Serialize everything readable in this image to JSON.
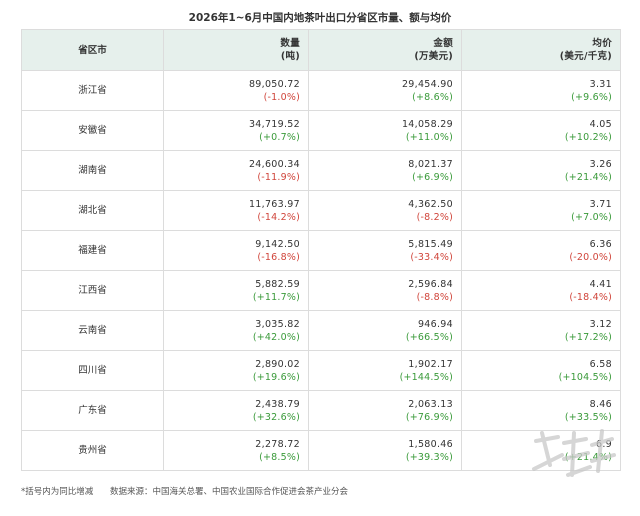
{
  "title": "2026年1~6月中国内地茶叶出口分省区市量、额与均价",
  "headers": {
    "province": "省区市",
    "qty_line1": "数量",
    "qty_line2": "(吨)",
    "amt_line1": "金额",
    "amt_line2": "(万美元)",
    "price_line1": "均价",
    "price_line2": "(美元/千克)"
  },
  "rows": [
    {
      "province": "浙江省",
      "qty": "89,050.72",
      "qty_chg": "(-1.0%)",
      "amt": "29,454.90",
      "amt_chg": "(+8.6%)",
      "price": "3.31",
      "price_chg": "(+9.6%)"
    },
    {
      "province": "安徽省",
      "qty": "34,719.52",
      "qty_chg": "(+0.7%)",
      "amt": "14,058.29",
      "amt_chg": "(+11.0%)",
      "price": "4.05",
      "price_chg": "(+10.2%)"
    },
    {
      "province": "湖南省",
      "qty": "24,600.34",
      "qty_chg": "(-11.9%)",
      "amt": "8,021.37",
      "amt_chg": "(+6.9%)",
      "price": "3.26",
      "price_chg": "(+21.4%)"
    },
    {
      "province": "湖北省",
      "qty": "11,763.97",
      "qty_chg": "(-14.2%)",
      "amt": "4,362.50",
      "amt_chg": "(-8.2%)",
      "price": "3.71",
      "price_chg": "(+7.0%)"
    },
    {
      "province": "福建省",
      "qty": "9,142.50",
      "qty_chg": "(-16.8%)",
      "amt": "5,815.49",
      "amt_chg": "(-33.4%)",
      "price": "6.36",
      "price_chg": "(-20.0%)"
    },
    {
      "province": "江西省",
      "qty": "5,882.59",
      "qty_chg": "(+11.7%)",
      "amt": "2,596.84",
      "amt_chg": "(-8.8%)",
      "price": "4.41",
      "price_chg": "(-18.4%)"
    },
    {
      "province": "云南省",
      "qty": "3,035.82",
      "qty_chg": "(+42.0%)",
      "amt": "946.94",
      "amt_chg": "(+66.5%)",
      "price": "3.12",
      "price_chg": "(+17.2%)"
    },
    {
      "province": "四川省",
      "qty": "2,890.02",
      "qty_chg": "(+19.6%)",
      "amt": "1,902.17",
      "amt_chg": "(+144.5%)",
      "price": "6.58",
      "price_chg": "(+104.5%)"
    },
    {
      "province": "广东省",
      "qty": "2,438.79",
      "qty_chg": "(+32.6%)",
      "amt": "2,063.13",
      "amt_chg": "(+76.9%)",
      "price": "8.46",
      "price_chg": "(+33.5%)"
    },
    {
      "province": "贵州省",
      "qty": "2,278.72",
      "qty_chg": "(+8.5%)",
      "amt": "1,580.46",
      "amt_chg": "(+39.3%)",
      "price": "6.9",
      "price_chg": "(+21.4%)"
    }
  ],
  "footnote": "*括号内为同比增减",
  "source": "数据来源：中国海关总署、中国农业国际合作促进会茶产业分会",
  "colors": {
    "increase": "#3a9a3a",
    "decrease": "#d0453b",
    "header_bg": "#e6f0ec"
  }
}
